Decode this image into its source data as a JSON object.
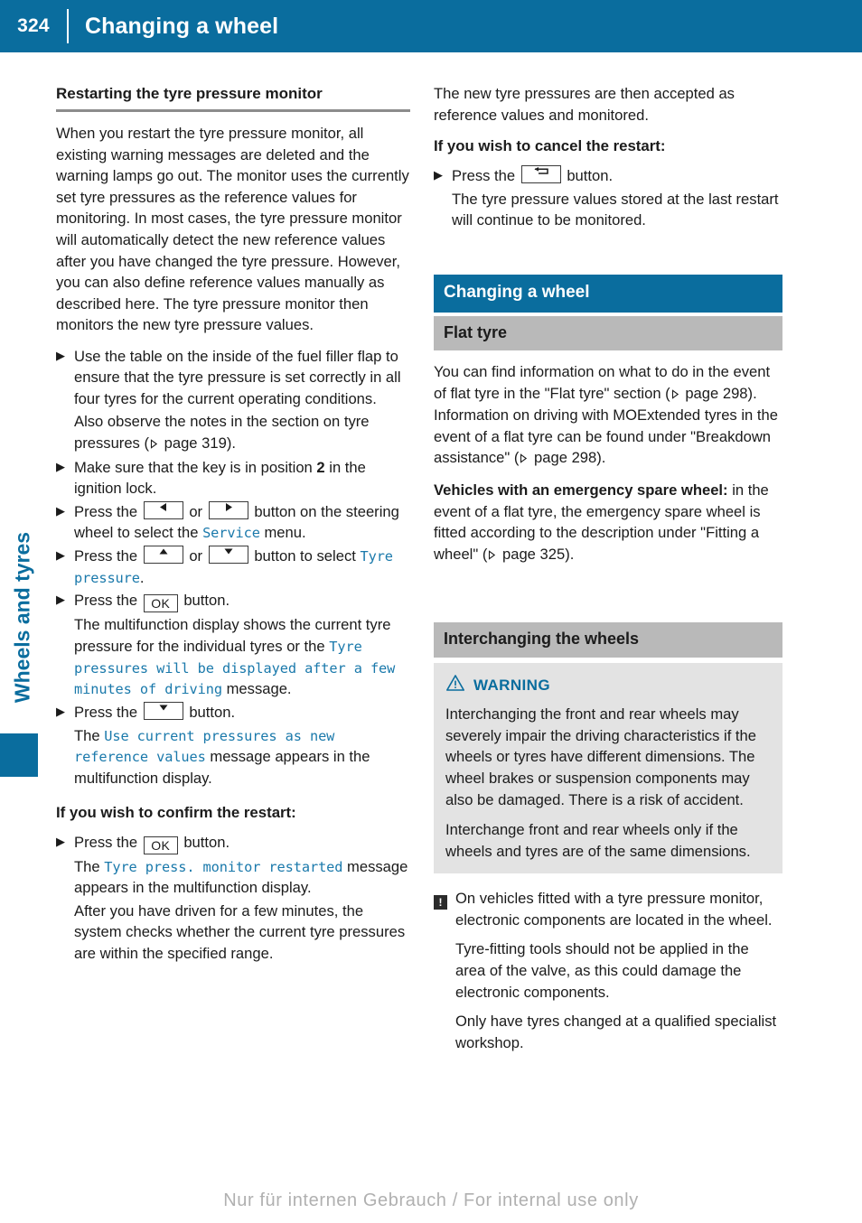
{
  "header": {
    "page_number": "324",
    "title": "Changing a wheel"
  },
  "side_tab": {
    "label": "Wheels and tyres",
    "color": "#0a6d9e"
  },
  "footer": {
    "watermark": "Nur für internen Gebrauch / For internal use only"
  },
  "left_column": {
    "heading": "Restarting the tyre pressure monitor",
    "intro": "When you restart the tyre pressure monitor, all existing warning messages are deleted and the warning lamps go out. The monitor uses the currently set tyre pressures as the reference values for monitoring. In most cases, the tyre pressure monitor will automatically detect the new reference values after you have changed the tyre pressure. However, you can also define reference values manually as described here. The tyre pressure monitor then monitors the new tyre pressure values.",
    "step1": "Use the table on the inside of the fuel filler flap to ensure that the tyre pressure is set correctly in all four tyres for the current operating conditions.",
    "step1_note_pre": "Also observe the notes in the section on tyre pressures (",
    "step1_note_page": " page 319).",
    "step2_pre": "Make sure that the key is in position ",
    "step2_bold": "2",
    "step2_post": " in the ignition lock.",
    "step3_pre": "Press the ",
    "step3_mid": " or ",
    "step3_post": " button on the steering wheel to select the ",
    "step3_menu": "Service",
    "step3_end": " menu.",
    "step4_pre": "Press the ",
    "step4_mid": " or ",
    "step4_post": " button to select ",
    "step4_menu": "Tyre pressure",
    "step4_end": ".",
    "step5_pre": "Press the ",
    "step5_btn": "OK",
    "step5_post": " button.",
    "step5_note_pre": "The multifunction display shows the current tyre pressure for the individual tyres or the ",
    "step5_note_msg": "Tyre pressures will be displayed after a few minutes of driving",
    "step5_note_post": " message.",
    "step6_pre": "Press the ",
    "step6_post": " button.",
    "step6_note_pre": "The ",
    "step6_note_msg": "Use current pressures as new reference values",
    "step6_note_post": " message appears in the multifunction display.",
    "confirm_heading": "If you wish to confirm the restart:",
    "confirm_step_pre": "Press the ",
    "confirm_step_btn": "OK",
    "confirm_step_post": " button.",
    "confirm_note_pre": "The ",
    "confirm_note_msg": "Tyre press. monitor restarted",
    "confirm_note_post": " message appears in the multifunction display.",
    "confirm_note2": "After you have driven for a few minutes, the system checks whether the current tyre pressures are within the specified range."
  },
  "right_column": {
    "top_para": "The new tyre pressures are then accepted as reference values and monitored.",
    "cancel_heading": "If you wish to cancel the restart:",
    "cancel_step_pre": "Press the ",
    "cancel_step_post": " button.",
    "cancel_note": "The tyre pressure values stored at the last restart will continue to be monitored.",
    "section_title": "Changing a wheel",
    "flat_tyre_title": "Flat tyre",
    "flat_tyre_p1_a": "You can find information on what to do in the event of flat tyre in the \"Flat tyre\" section (",
    "flat_tyre_p1_b": " page 298). Information on driving with MOExtended tyres in the event of a flat tyre can be found under \"Breakdown assistance\" (",
    "flat_tyre_p1_c": " page 298).",
    "spare_bold": "Vehicles with an emergency spare wheel:",
    "spare_rest": " in the event of a flat tyre, the emergency spare wheel is fitted according to the description under \"Fitting a wheel\" (",
    "spare_page": " page 325).",
    "interchanging_title": "Interchanging the wheels",
    "warning_label": "WARNING",
    "warning_p1": "Interchanging the front and rear wheels may severely impair the driving characteristics if the wheels or tyres have different dimensions. The wheel brakes or suspension components may also be damaged. There is a risk of accident.",
    "warning_p2": "Interchange front and rear wheels only if the wheels and tyres are of the same dimensions.",
    "notice_badge": "!",
    "notice_p1": "On vehicles fitted with a tyre pressure monitor, electronic components are located in the wheel.",
    "notice_p2": "Tyre-fitting tools should not be applied in the area of the valve, as this could damage the electronic components.",
    "notice_p3": "Only have tyres changed at a qualified specialist workshop."
  },
  "icons": {
    "bullet": "▶",
    "arrow_left": "left-triangle",
    "arrow_right": "right-triangle",
    "arrow_up": "up-triangle",
    "arrow_down": "down-triangle",
    "back": "back-arrow",
    "xref": "right-triangle-outline",
    "warning": "warning-triangle"
  },
  "colors": {
    "brand_blue": "#0a6d9e",
    "display_text_blue": "#1a79ab",
    "grey_bar": "#b9b9b9",
    "warn_bg": "#e3e3e3"
  }
}
